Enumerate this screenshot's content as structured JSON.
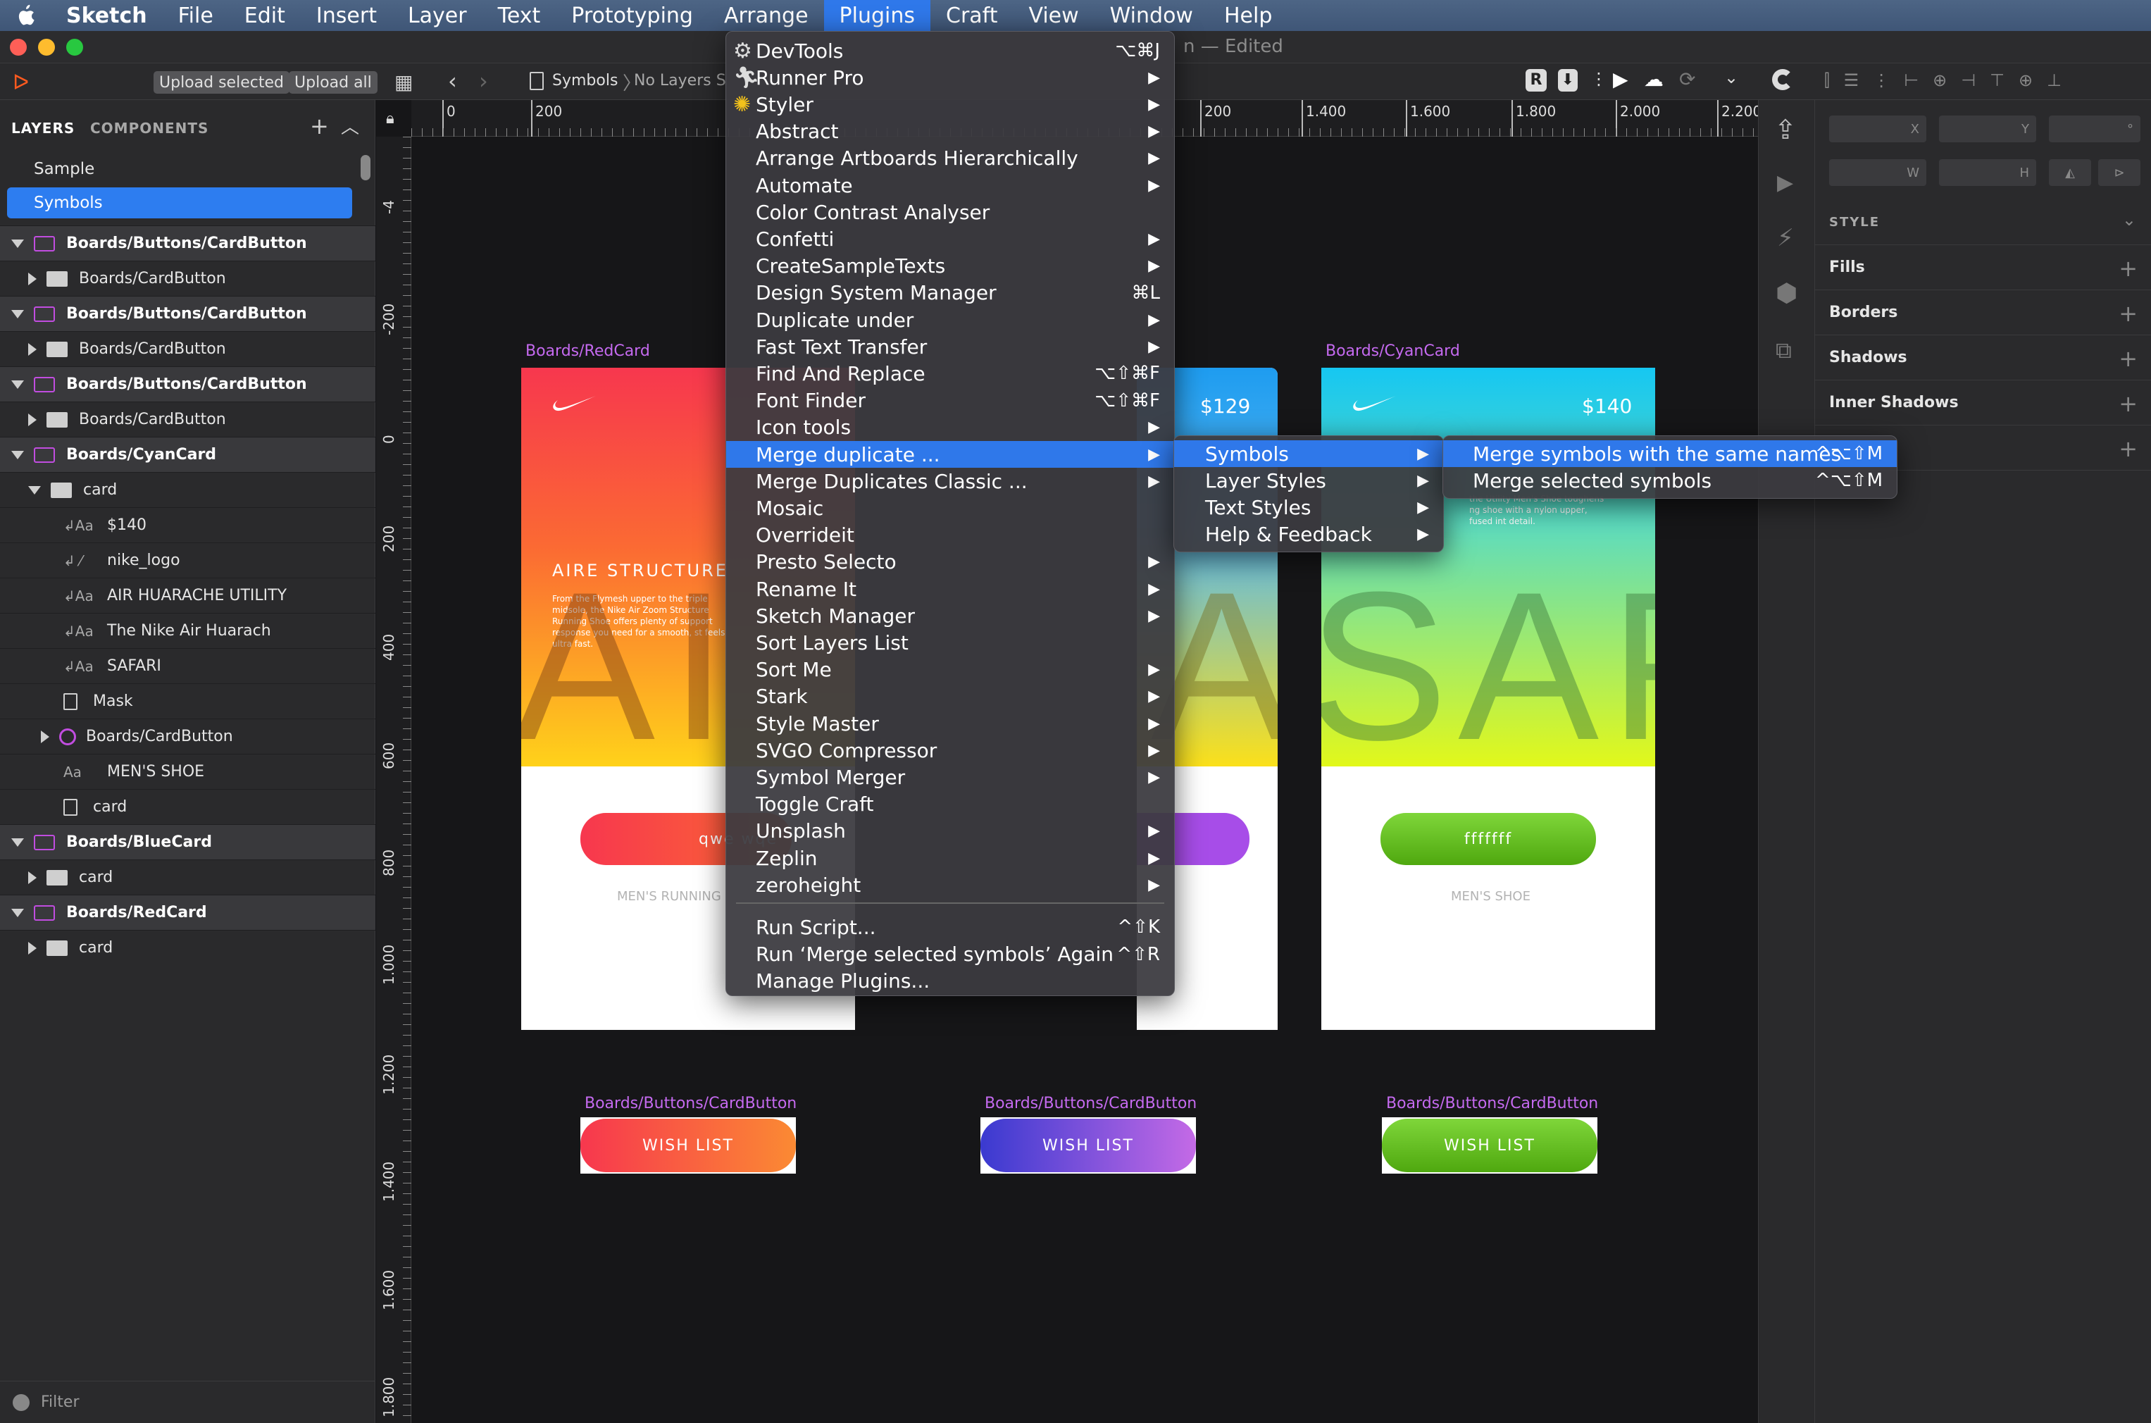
{
  "menubar": {
    "app": "Sketch",
    "items": [
      "File",
      "Edit",
      "Insert",
      "Layer",
      "Text",
      "Prototyping",
      "Arrange",
      "Plugins",
      "Craft",
      "View",
      "Window",
      "Help"
    ]
  },
  "window": {
    "title_suffix": "n — Edited"
  },
  "toolbar": {
    "upload_selected": "Upload selected",
    "upload_all": "Upload all",
    "breadcrumb_page": "Symbols",
    "breadcrumb_layer": "No Layers Se"
  },
  "sidebar": {
    "tab_layers": "LAYERS",
    "tab_components": "COMPONENTS",
    "pages": [
      "Sample",
      "Symbols"
    ],
    "layers": [
      {
        "label": "Boards/Buttons/CardButton",
        "kind": "artboard"
      },
      {
        "label": "Boards/CardButton",
        "kind": "folder"
      },
      {
        "label": "Boards/Buttons/CardButton",
        "kind": "artboard"
      },
      {
        "label": "Boards/CardButton",
        "kind": "folder"
      },
      {
        "label": "Boards/Buttons/CardButton",
        "kind": "artboard"
      },
      {
        "label": "Boards/CardButton",
        "kind": "folder"
      },
      {
        "label": "Boards/CyanCard",
        "kind": "artboard"
      },
      {
        "label": "card",
        "kind": "folder-open"
      },
      {
        "label": "$140",
        "kind": "text"
      },
      {
        "label": "nike_logo",
        "kind": "shape"
      },
      {
        "label": "AIR HUARACHE UTILITY",
        "kind": "text"
      },
      {
        "label": "The Nike Air Huarach",
        "kind": "text"
      },
      {
        "label": "SAFARI",
        "kind": "text"
      },
      {
        "label": "Mask",
        "kind": "rect"
      },
      {
        "label": "Boards/CardButton",
        "kind": "symbol"
      },
      {
        "label": "MEN'S SHOE",
        "kind": "text-plain"
      },
      {
        "label": "card",
        "kind": "rect-small"
      },
      {
        "label": "Boards/BlueCard",
        "kind": "artboard"
      },
      {
        "label": "card",
        "kind": "folder"
      },
      {
        "label": "Boards/RedCard",
        "kind": "artboard"
      },
      {
        "label": "card",
        "kind": "folder"
      }
    ],
    "filter": "Filter"
  },
  "rulers": {
    "h": [
      "0",
      "200",
      "200",
      "1.400",
      "1.600",
      "1.800",
      "2.000",
      "2.200"
    ],
    "v": [
      "-4",
      "-200",
      "0",
      "200",
      "400",
      "600",
      "800",
      "1.000",
      "1.200",
      "1.400",
      "1.600",
      "1.800"
    ]
  },
  "canvas": {
    "red_card": {
      "label": "Boards/RedCard",
      "heading": "AIRE STRUCTURE",
      "body": "From the Flymesh upper to the triple midsole, the Nike Air Zoom Structure Running Shoe offers plenty of support response you need for a smooth, st feels ultra fast.",
      "big_text": "AI",
      "button": "qwe wqe",
      "footer": "MEN'S RUNNING"
    },
    "blue_card": {
      "price": "$129",
      "big_text": "A"
    },
    "cyan_card": {
      "label": "Boards/CyanCard",
      "price": "$140",
      "body": "the Utility Men's Shoe toughens ng shoe with a nylon upper, fused int detail.",
      "big_text": "SAF",
      "button": "fffffff",
      "footer": "MEN'S SHOE"
    },
    "buttons": [
      {
        "label": "Boards/Buttons/CardButton",
        "text": "WISH LIST"
      },
      {
        "label": "Boards/Buttons/CardButton",
        "text": "WISH LIST"
      },
      {
        "label": "Boards/Buttons/CardButton",
        "text": "WISH LIST"
      }
    ]
  },
  "inspector": {
    "x": "X",
    "y": "Y",
    "w": "W",
    "h": "H",
    "deg": "°",
    "style": "STYLE",
    "sections": [
      "Fills",
      "Borders",
      "Shadows",
      "Inner Shadows"
    ]
  },
  "plugins_menu": {
    "items": [
      {
        "label": "DevTools",
        "shortcut": "⌥⌘J"
      },
      {
        "label": "Runner Pro",
        "arrow": "▶"
      },
      {
        "label": "Styler",
        "arrow": "▶"
      },
      {
        "label": "Abstract",
        "arrow": "▶"
      },
      {
        "label": "Arrange Artboards Hierarchically",
        "arrow": "▶"
      },
      {
        "label": "Automate",
        "arrow": "▶"
      },
      {
        "label": "Color Contrast Analyser"
      },
      {
        "label": "Confetti",
        "arrow": "▶"
      },
      {
        "label": "CreateSampleTexts",
        "arrow": "▶"
      },
      {
        "label": "Design System Manager",
        "shortcut": "⌘L"
      },
      {
        "label": "Duplicate under",
        "arrow": "▶"
      },
      {
        "label": "Fast Text Transfer",
        "arrow": "▶"
      },
      {
        "label": "Find And Replace",
        "shortcut": "⌥⇧⌘F"
      },
      {
        "label": "Font Finder",
        "shortcut": "⌥⇧⌘F"
      },
      {
        "label": "Icon tools",
        "arrow": "▶"
      },
      {
        "label": "Merge duplicate ...",
        "arrow": "▶"
      },
      {
        "label": "Merge Duplicates Classic ...",
        "arrow": "▶"
      },
      {
        "label": "Mosaic"
      },
      {
        "label": "Overrideit"
      },
      {
        "label": "Presto Selecto",
        "arrow": "▶"
      },
      {
        "label": "Rename It",
        "arrow": "▶"
      },
      {
        "label": "Sketch Manager",
        "arrow": "▶"
      },
      {
        "label": "Sort Layers List"
      },
      {
        "label": "Sort Me",
        "arrow": "▶"
      },
      {
        "label": "Stark",
        "arrow": "▶"
      },
      {
        "label": "Style Master",
        "arrow": "▶"
      },
      {
        "label": "SVGO Compressor",
        "arrow": "▶"
      },
      {
        "label": "Symbol Merger",
        "arrow": "▶"
      },
      {
        "label": "Toggle Craft"
      },
      {
        "label": "Unsplash",
        "arrow": "▶"
      },
      {
        "label": "Zeplin",
        "arrow": "▶"
      },
      {
        "label": "zeroheight",
        "arrow": "▶"
      }
    ],
    "footer": [
      {
        "label": "Run Script...",
        "shortcut": "^⇧K"
      },
      {
        "label": "Run ‘Merge selected symbols’ Again",
        "shortcut": "^⇧R"
      },
      {
        "label": "Manage Plugins..."
      }
    ]
  },
  "submenu": [
    {
      "label": "Symbols",
      "arrow": "▶"
    },
    {
      "label": "Layer Styles",
      "arrow": "▶"
    },
    {
      "label": "Text Styles",
      "arrow": "▶"
    },
    {
      "label": "Help & Feedback",
      "arrow": "▶"
    }
  ],
  "submenu2": [
    {
      "label": "Merge symbols with the same names",
      "shortcut": "^⌥⇧M"
    },
    {
      "label": "Merge selected symbols",
      "shortcut": "^⌥⇧M"
    }
  ],
  "colors": {
    "accent": "#2f78ea",
    "artboard_label": "#c56af0"
  }
}
